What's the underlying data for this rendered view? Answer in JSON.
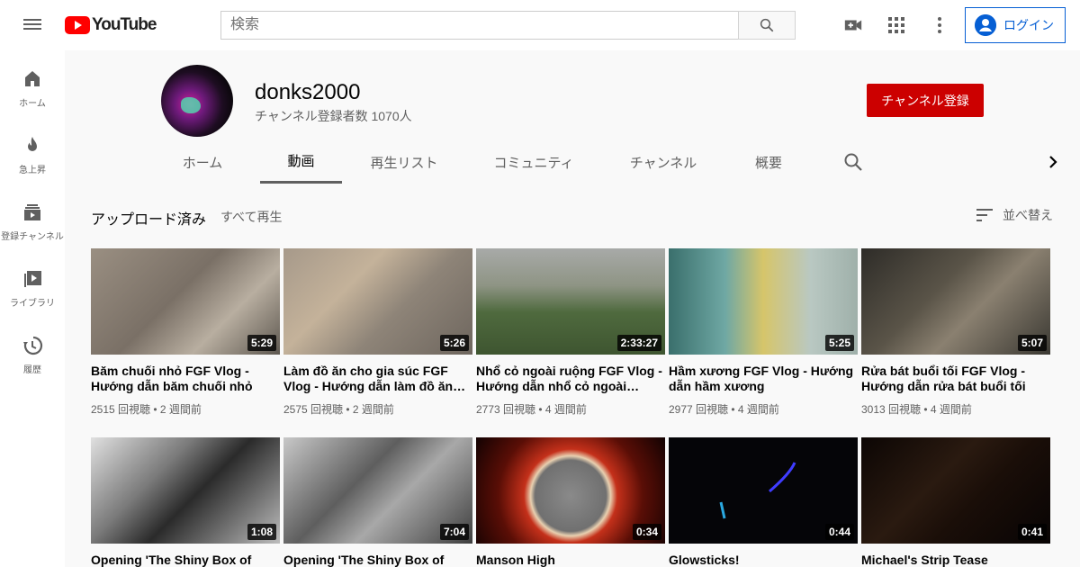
{
  "header": {
    "logo_text": "YouTube",
    "search_placeholder": "検索",
    "login_label": "ログイン"
  },
  "sidebar": {
    "items": [
      {
        "label": "ホーム",
        "icon": "home-icon"
      },
      {
        "label": "急上昇",
        "icon": "flame-icon"
      },
      {
        "label": "登録チャンネル",
        "icon": "subscriptions-icon"
      },
      {
        "label": "ライブラリ",
        "icon": "library-icon"
      },
      {
        "label": "履歴",
        "icon": "history-icon"
      }
    ]
  },
  "channel": {
    "name": "donks2000",
    "subscribers": "チャンネル登録者数 1070人",
    "subscribe_label": "チャンネル登録",
    "tabs": [
      "ホーム",
      "動画",
      "再生リスト",
      "コミュニティ",
      "チャンネル",
      "概要"
    ],
    "active_tab": "動画"
  },
  "section": {
    "title": "アップロード済み",
    "play_all": "すべて再生",
    "sort_label": "並べ替え"
  },
  "videos": [
    {
      "title": "Băm chuối nhỏ FGF Vlog - Hướng dẫn băm chuối nhỏ",
      "views": "2515 回視聴",
      "age": "2 週間前",
      "duration": "5:29",
      "thumb_color": "#8a8378"
    },
    {
      "title": "Làm đồ ăn cho gia súc FGF Vlog - Hướng dẫn làm đồ ăn cho gia súc",
      "views": "2575 回視聴",
      "age": "2 週間前",
      "duration": "5:26",
      "thumb_color": "#928678"
    },
    {
      "title": "Nhổ cỏ ngoài ruộng FGF Vlog - Hướng dẫn nhổ cỏ ngoài ruộng",
      "views": "2773 回視聴",
      "age": "4 週間前",
      "duration": "2:33:27",
      "thumb_color": "#6f7d5e"
    },
    {
      "title": "Hầm xương FGF Vlog - Hướng dẫn hầm xương",
      "views": "2977 回視聴",
      "age": "4 週間前",
      "duration": "5:25",
      "thumb_color": "#5b8f8c"
    },
    {
      "title": "Rửa bát buổi tối FGF Vlog - Hướng dẫn rửa bát buổi tối",
      "views": "3013 回視聴",
      "age": "4 週間前",
      "duration": "5:07",
      "thumb_color": "#4a4a44"
    },
    {
      "title": "Opening 'The Shiny Box of",
      "views": "",
      "age": "",
      "duration": "1:08",
      "thumb_color": "#6b6b6b"
    },
    {
      "title": "Opening 'The Shiny Box of",
      "views": "",
      "age": "",
      "duration": "7:04",
      "thumb_color": "#8c8c8c"
    },
    {
      "title": "Manson High",
      "views": "",
      "age": "",
      "duration": "0:34",
      "thumb_color": "#4a0d08"
    },
    {
      "title": "Glowsticks!",
      "views": "",
      "age": "",
      "duration": "0:44",
      "thumb_color": "#050508"
    },
    {
      "title": "Michael's Strip Tease",
      "views": "",
      "age": "",
      "duration": "0:41",
      "thumb_color": "#1a0d08"
    }
  ]
}
